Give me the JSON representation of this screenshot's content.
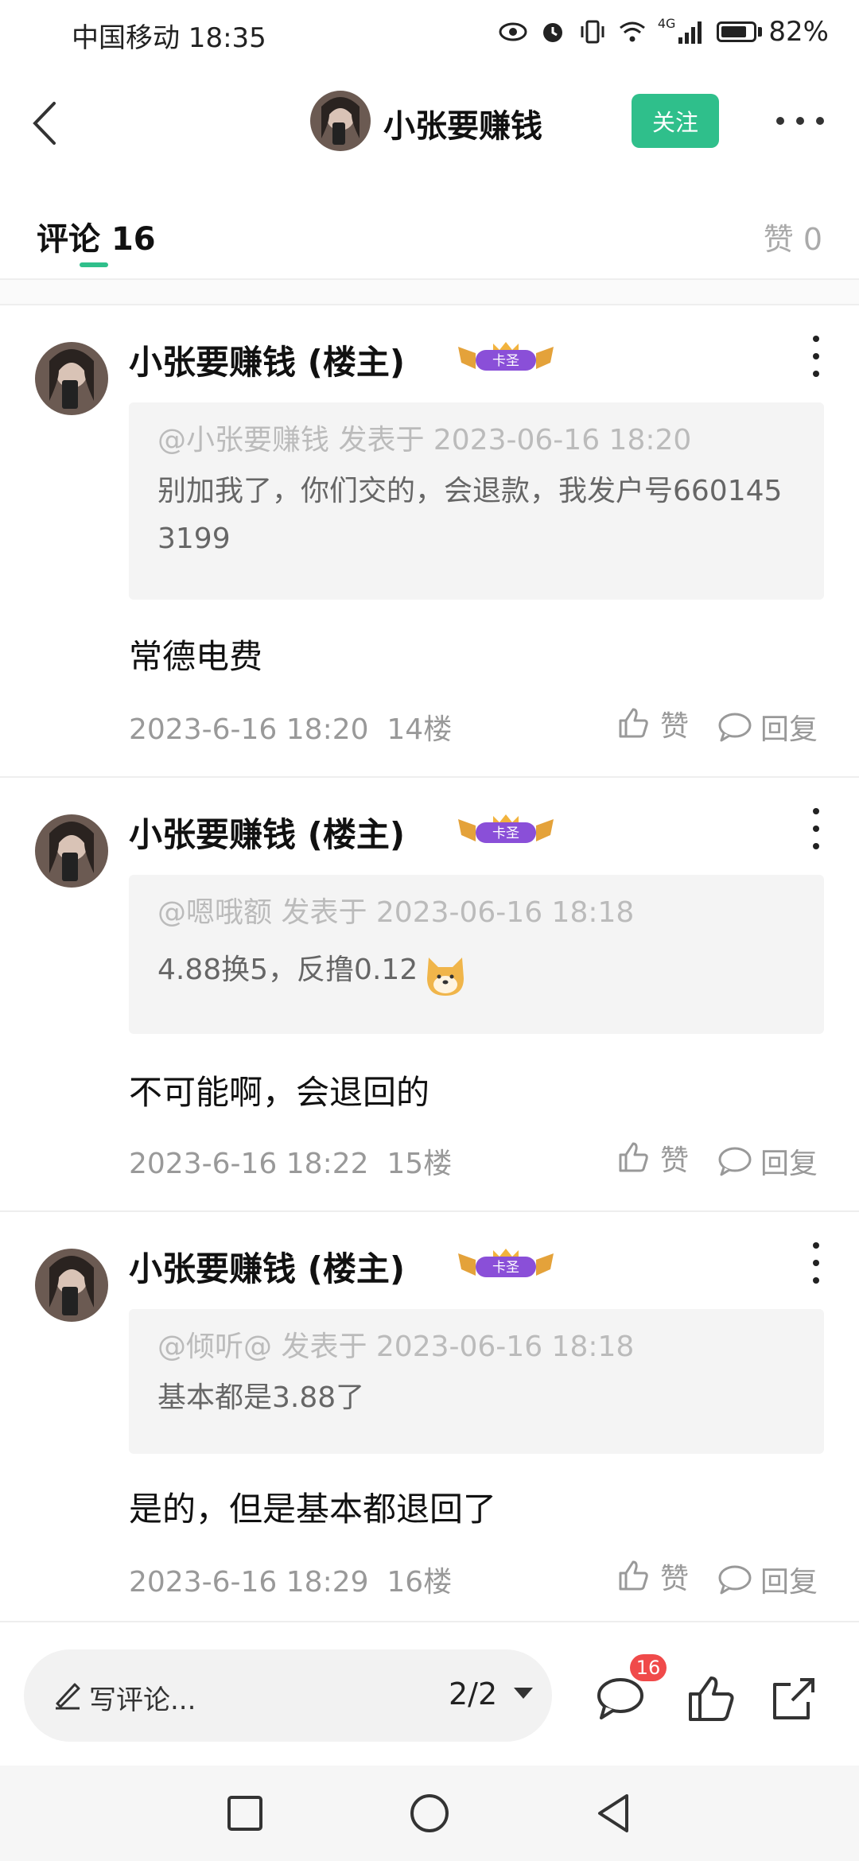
{
  "status_bar": {
    "carrier_time": "中国移动 18:35",
    "network": "4G",
    "battery": "82%",
    "battery_level": 0.82
  },
  "header": {
    "title": "小张要赚钱",
    "follow_label": "关注"
  },
  "tabs": {
    "comments_label": "评论",
    "comments_count": "16",
    "likes_label": "赞 0"
  },
  "comments": [
    {
      "name": "小张要赚钱 (楼主)",
      "badge_text": "卡圣",
      "quote_meta": "@小张要赚钱 发表于 2023-06-16 18:20",
      "quote_text": "别加我了，你们交的，会退款，我发户号6601453199",
      "body": "常德电费",
      "date": "2023-6-16 18:20",
      "floor": "14楼",
      "like_label": "赞",
      "reply_label": "回复"
    },
    {
      "name": "小张要赚钱 (楼主)",
      "badge_text": "卡圣",
      "quote_meta": "@嗯哦额 发表于 2023-06-16 18:18",
      "quote_text": "4.88换5，反撸0.12",
      "body": "不可能啊，会退回的",
      "date": "2023-6-16 18:22",
      "floor": "15楼",
      "like_label": "赞",
      "reply_label": "回复"
    },
    {
      "name": "小张要赚钱 (楼主)",
      "badge_text": "卡圣",
      "quote_meta": "@倾听@ 发表于 2023-06-16 18:18",
      "quote_text": "基本都是3.88了",
      "body": "是的，但是基本都退回了",
      "date": "2023-6-16 18:29",
      "floor": "16楼",
      "like_label": "赞",
      "reply_label": "回复"
    }
  ],
  "composer": {
    "placeholder": "写评论...",
    "pager": "2/2",
    "comment_count": "16"
  },
  "colors": {
    "accent": "#2fbf8b",
    "badge_red": "#f04a4a"
  }
}
